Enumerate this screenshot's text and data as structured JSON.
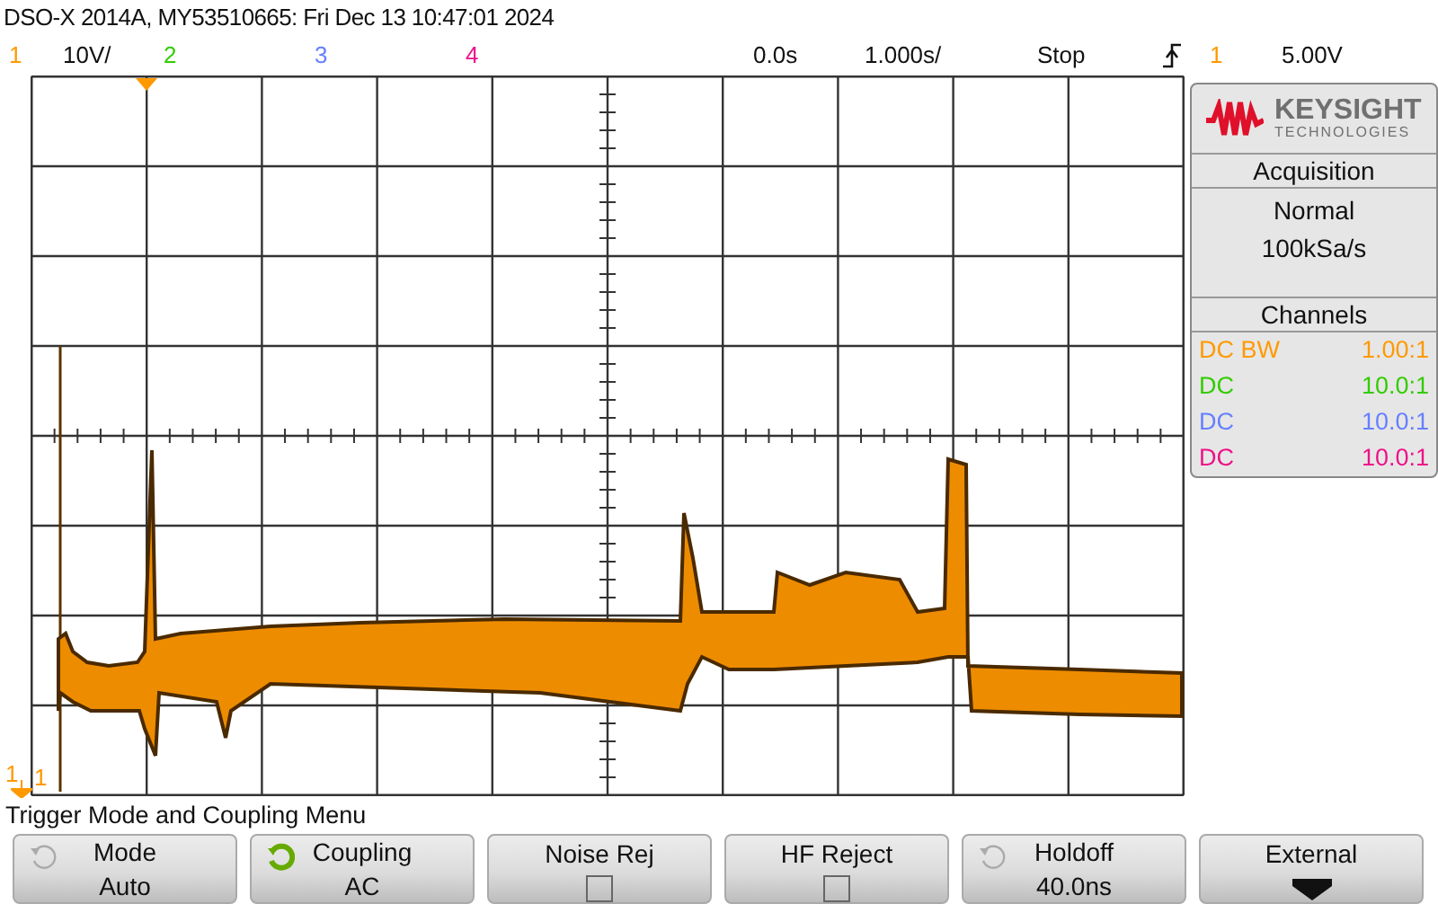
{
  "title": "DSO-X 2014A, MY53510665: Fri Dec 13 10:47:01 2024",
  "status_bar": {
    "channels": [
      {
        "label": "1",
        "color": "#ff9900",
        "scale": "10V/"
      },
      {
        "label": "2",
        "color": "#33cc00"
      },
      {
        "label": "3",
        "color": "#6680ff"
      },
      {
        "label": "4",
        "color": "#ee1188"
      }
    ],
    "time_offset": "0.0s",
    "timebase": "1.000s/",
    "run_state": "Stop",
    "trigger_source": "1",
    "trigger_level": "5.00V"
  },
  "display": {
    "ground_marker": "1",
    "trace_label": "1"
  },
  "panel": {
    "logo": {
      "name": "KEYSIGHT",
      "subtitle": "TECHNOLOGIES"
    },
    "acquisition": {
      "title": "Acquisition",
      "mode": "Normal",
      "rate": "100kSa/s"
    },
    "channels": {
      "title": "Channels",
      "items": [
        {
          "coupling": "DC BW",
          "probe": "1.00:1",
          "color": "#ff9900"
        },
        {
          "coupling": "DC",
          "probe": "10.0:1",
          "color": "#33cc00"
        },
        {
          "coupling": "DC",
          "probe": "10.0:1",
          "color": "#6680ff"
        },
        {
          "coupling": "DC",
          "probe": "10.0:1",
          "color": "#ee1188"
        }
      ]
    }
  },
  "menu": {
    "title": "Trigger Mode and Coupling Menu",
    "softkeys": [
      {
        "kind": "cycle",
        "label": "Mode",
        "value": "Auto",
        "active": false
      },
      {
        "kind": "cycle",
        "label": "Coupling",
        "value": "AC",
        "active": true
      },
      {
        "kind": "checkbox",
        "label": "Noise Rej",
        "checked": false
      },
      {
        "kind": "checkbox",
        "label": "HF Reject",
        "checked": false
      },
      {
        "kind": "cycle",
        "label": "Holdoff",
        "value": "40.0ns",
        "active": false
      },
      {
        "kind": "submenu",
        "label": "External"
      }
    ]
  }
}
